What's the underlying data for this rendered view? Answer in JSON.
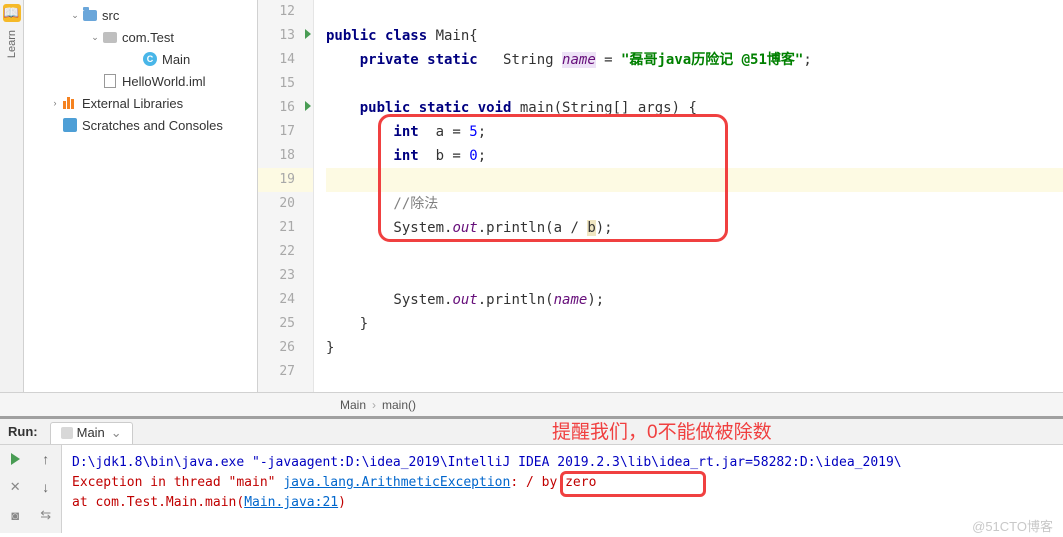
{
  "leftBar": {
    "label": "Learn"
  },
  "tree": {
    "items": [
      {
        "indent": 44,
        "arrow": "⌄",
        "icon": "folder-blue",
        "label": "src"
      },
      {
        "indent": 64,
        "arrow": "⌄",
        "icon": "folder-gray",
        "label": "com.Test"
      },
      {
        "indent": 104,
        "arrow": "",
        "icon": "java",
        "label": "Main"
      },
      {
        "indent": 64,
        "arrow": "",
        "icon": "file",
        "label": "HelloWorld.iml"
      },
      {
        "indent": 24,
        "arrow": "›",
        "icon": "lib",
        "label": "External Libraries"
      },
      {
        "indent": 24,
        "arrow": "",
        "icon": "scratch",
        "label": "Scratches and Consoles"
      }
    ]
  },
  "gutter": {
    "lines": [
      12,
      13,
      14,
      15,
      16,
      17,
      18,
      19,
      20,
      21,
      22,
      23,
      24,
      25,
      26,
      27
    ],
    "marks": {
      "13": true,
      "16": true
    }
  },
  "code": {
    "l12": "",
    "l13_1": "public class ",
    "l13_2": "Main{",
    "l14_1": "    private static   ",
    "l14_2": "String ",
    "l14_3": "name",
    "l14_4": " = ",
    "l14_5": "\"磊哥java历险记 @51博客\"",
    "l14_6": ";",
    "l15": "",
    "l16_1": "    public static void ",
    "l16_2": "main(String[] args) {",
    "l17_1": "        int  ",
    "l17_2": "a = ",
    "l17_3": "5",
    "l17_4": ";",
    "l18_1": "        int  ",
    "l18_2": "b = ",
    "l18_3": "0",
    "l18_4": ";",
    "l19": "",
    "l20": "        //除法",
    "l21_1": "        System.",
    "l21_2": "out",
    "l21_3": ".println(a / ",
    "l21_4": "b",
    "l21_5": ");",
    "l22": "",
    "l23": "",
    "l24_1": "        System.",
    "l24_2": "out",
    "l24_3": ".println(",
    "l24_4": "name",
    "l24_5": ");",
    "l25": "    }",
    "l26": "}",
    "l27": ""
  },
  "breadcrumb": {
    "a": "Main",
    "b": "main()"
  },
  "run": {
    "title": "Run:",
    "tab": "Main",
    "line1": "D:\\jdk1.8\\bin\\java.exe \"-javaagent:D:\\idea_2019\\IntelliJ IDEA 2019.2.3\\lib\\idea_rt.jar=58282:D:\\idea_2019\\",
    "line2a": "Exception in thread \"main\" ",
    "line2b": "java.lang.ArithmeticException",
    "line2c": ": / by zero",
    "line3a": "    at com.Test.Main.main(",
    "line3b": "Main.java:21",
    "line3c": ")"
  },
  "annotation": "提醒我们，0不能做被除数",
  "watermark": "@51CTO博客"
}
